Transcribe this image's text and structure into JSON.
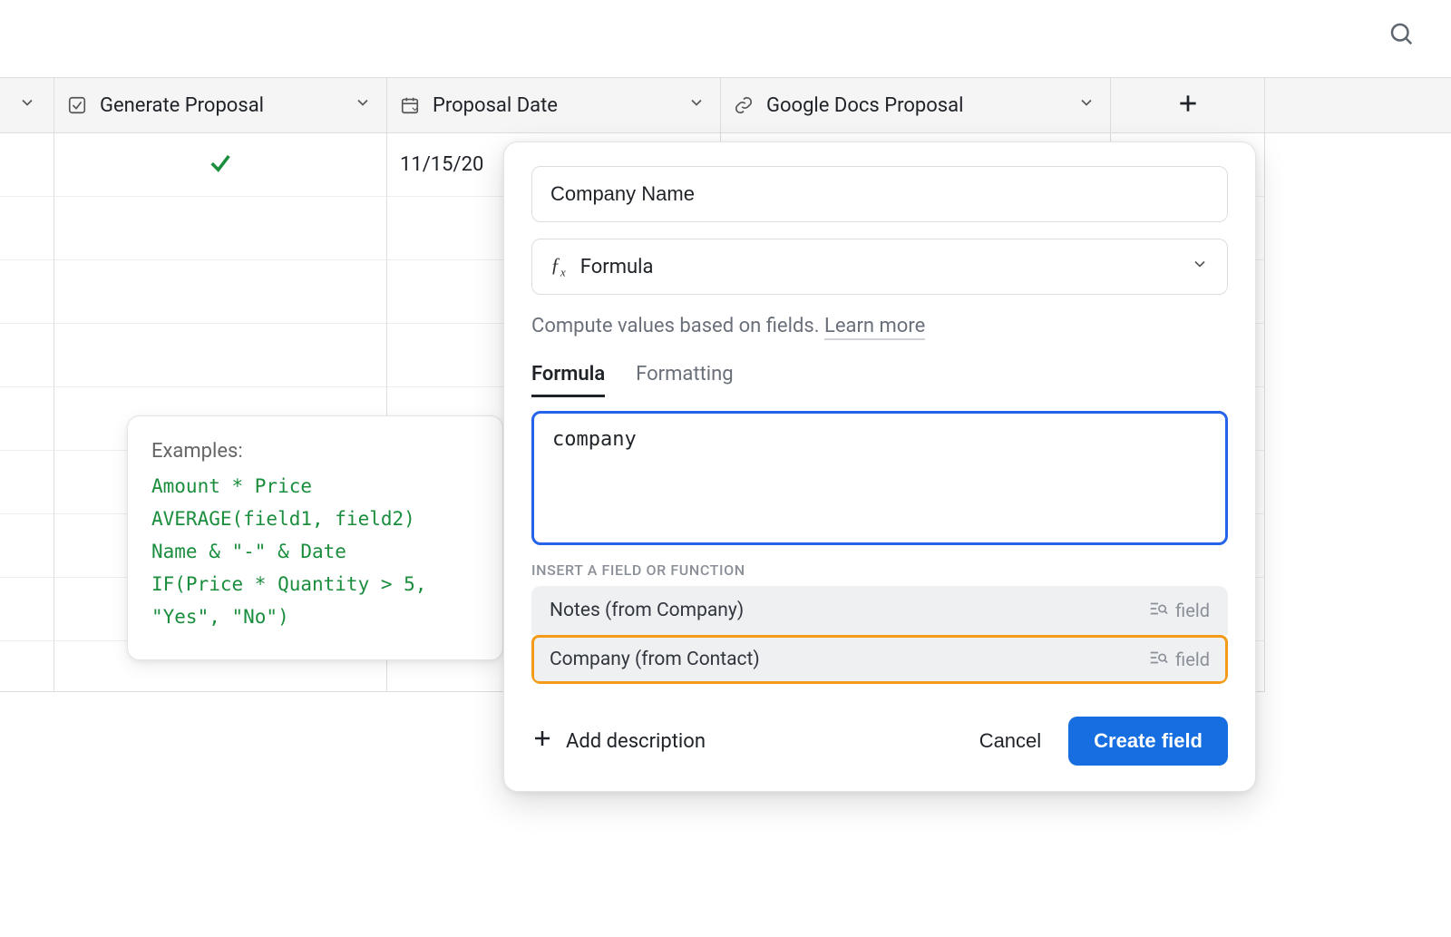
{
  "columns": {
    "generate_proposal": {
      "label": "Generate Proposal"
    },
    "proposal_date": {
      "label": "Proposal Date"
    },
    "google_docs_proposal": {
      "label": "Google Docs Proposal"
    }
  },
  "rows": [
    {
      "generate_proposal_checked": true,
      "proposal_date": "11/15/20"
    }
  ],
  "examples": {
    "title": "Examples:",
    "code": "Amount * Price\nAVERAGE(field1, field2)\nName & \"-\" & Date\nIF(Price * Quantity > 5,\n\"Yes\", \"No\")"
  },
  "popover": {
    "field_name": "Company Name",
    "type_label": "Formula",
    "hint_text": "Compute values based on fields. ",
    "learn_more": "Learn more",
    "tabs": {
      "formula": "Formula",
      "formatting": "Formatting"
    },
    "formula_value": "company",
    "suggest_label": "INSERT A FIELD OR FUNCTION",
    "suggestions": [
      {
        "label": "Notes (from Company)",
        "kind": "field"
      },
      {
        "label": "Company (from Contact)",
        "kind": "field"
      }
    ],
    "add_description": "Add description",
    "cancel": "Cancel",
    "create": "Create field"
  }
}
